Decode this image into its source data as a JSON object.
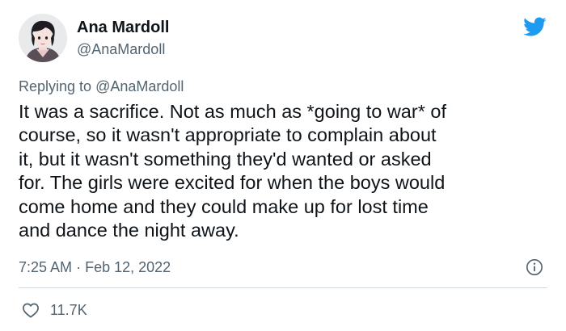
{
  "author": {
    "name": "Ana Mardoll",
    "handle": "@AnaMardoll"
  },
  "replying_to": {
    "prefix": "Replying to",
    "handle": "@AnaMardoll"
  },
  "tweet": {
    "lines": [
      "It was a sacrifice. Not as much as *going to war* of",
      "course, so it wasn't appropriate to complain about",
      "it, but it wasn't something they'd wanted or asked",
      "for. The girls were excited for when the boys would",
      "come home and they could make up for lost time",
      "and dance the night away."
    ],
    "time": "7:25 AM",
    "separator": "·",
    "date": "Feb 12, 2022"
  },
  "stats": {
    "likes": "11.7K"
  },
  "icons": {
    "brand": "twitter-bird-icon",
    "info": "info-icon",
    "like": "heart-icon"
  },
  "colors": {
    "brand_blue": "#1d9bf0",
    "text": "#0f1419",
    "muted": "#536471",
    "divider": "#cfd9de"
  }
}
